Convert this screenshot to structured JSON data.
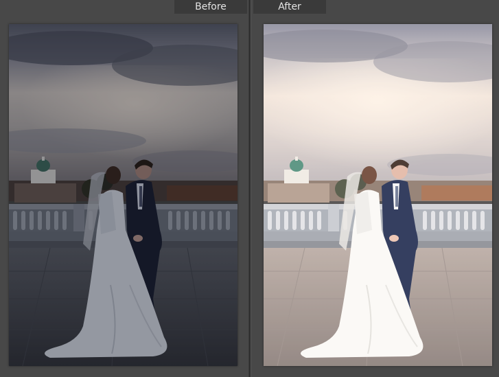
{
  "compare_view": {
    "before_label": "Before",
    "after_label": "After"
  }
}
